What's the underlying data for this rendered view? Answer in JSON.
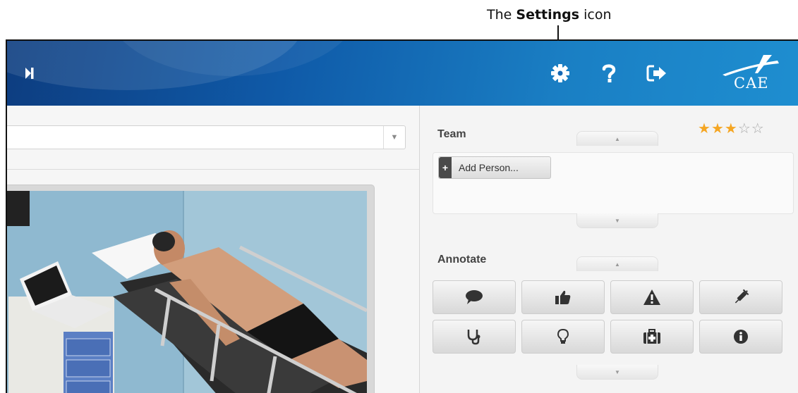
{
  "callout": {
    "prefix": "The ",
    "bold": "Settings",
    "suffix": " icon"
  },
  "header": {
    "skip_icon": "skip-forward-icon",
    "settings_icon": "gear-icon",
    "help_icon": "question-mark-icon",
    "logout_icon": "sign-out-icon",
    "logo_text": "CAE",
    "colors": {
      "bar_dark": "#0d3d80",
      "bar_light": "#1e8ed0"
    }
  },
  "left": {
    "scenario_select": {
      "value": "",
      "arrow_icon": "caret-down-icon"
    },
    "video": {
      "description_icon": "patient-video"
    }
  },
  "right": {
    "team": {
      "title": "Team",
      "rating": {
        "value": 3,
        "max": 5,
        "color": "#f5a623"
      },
      "add_person_label": "Add Person...",
      "add_icon": "plus-icon"
    },
    "annotate": {
      "title": "Annotate",
      "buttons": [
        {
          "icon": "comment-icon"
        },
        {
          "icon": "thumbs-up-icon"
        },
        {
          "icon": "warning-icon"
        },
        {
          "icon": "syringe-icon"
        },
        {
          "icon": "stethoscope-icon"
        },
        {
          "icon": "lightbulb-icon"
        },
        {
          "icon": "medkit-icon"
        },
        {
          "icon": "info-icon"
        }
      ]
    }
  }
}
